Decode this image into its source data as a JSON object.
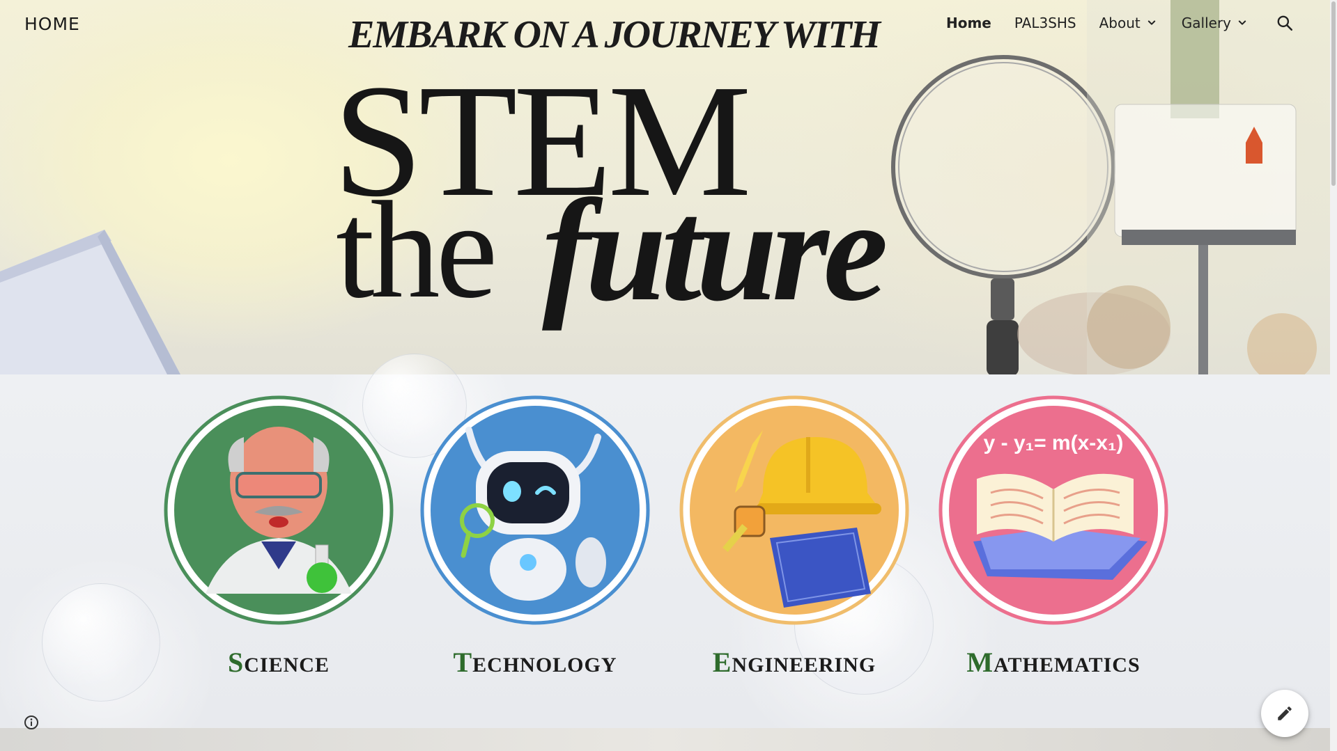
{
  "header": {
    "site_title": "HOME",
    "nav": [
      {
        "label": "Home",
        "active": true,
        "has_dropdown": false
      },
      {
        "label": "PAL3SHS",
        "active": false,
        "has_dropdown": false
      },
      {
        "label": "About",
        "active": false,
        "has_dropdown": true
      },
      {
        "label": "Gallery",
        "active": false,
        "has_dropdown": true
      }
    ],
    "search_icon": "search-icon"
  },
  "hero": {
    "tagline": "EMBARK ON A JOURNEY WITH",
    "headline_1": "STEM",
    "headline_2": "the",
    "headline_3": "future"
  },
  "stem": {
    "cards": [
      {
        "initial": "S",
        "rest": "CIENCE",
        "color": "#4a8f5a",
        "ring": "#4a8f5a",
        "icon": "scientist-icon"
      },
      {
        "initial": "T",
        "rest": "ECHNOLOGY",
        "color": "#4a8fd0",
        "ring": "#4a8fd0",
        "icon": "robot-icon"
      },
      {
        "initial": "E",
        "rest": "NGINEERING",
        "color": "#f3b862",
        "ring": "#f0bd6c",
        "icon": "hardhat-icon"
      },
      {
        "initial": "M",
        "rest": "ATHEMATICS",
        "color": "#ec6f8e",
        "ring": "#ec6f8e",
        "icon": "book-icon"
      }
    ],
    "math_formula": "y - y₁= m(x-x₁)"
  },
  "footer": {
    "info_icon": "info-icon",
    "edit_icon": "pencil-icon"
  },
  "colors": {
    "initial_green": "#2e6b2c",
    "text_dark": "#1b1b1b"
  }
}
